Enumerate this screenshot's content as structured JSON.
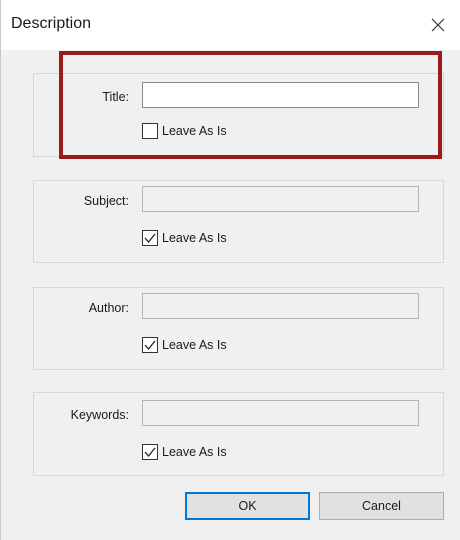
{
  "dialog": {
    "title": "Description",
    "close_icon": "close-icon"
  },
  "fields": [
    {
      "label": "Title:",
      "value": "",
      "leave_as_is": false,
      "checkbox_label": "Leave As Is"
    },
    {
      "label": "Subject:",
      "value": "",
      "leave_as_is": true,
      "checkbox_label": "Leave As Is"
    },
    {
      "label": "Author:",
      "value": "",
      "leave_as_is": true,
      "checkbox_label": "Leave As Is"
    },
    {
      "label": "Keywords:",
      "value": "",
      "leave_as_is": true,
      "checkbox_label": "Leave As Is"
    }
  ],
  "buttons": {
    "ok_label": "OK",
    "cancel_label": "Cancel"
  },
  "colors": {
    "highlight": "#9a1b1b",
    "default_button_border": "#0078d7"
  }
}
